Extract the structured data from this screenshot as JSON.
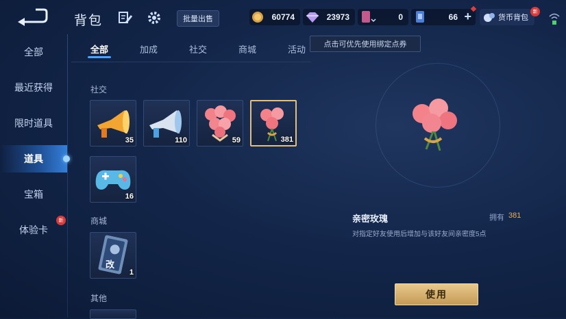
{
  "header": {
    "title": "背包",
    "bulk_sell": "批量出售"
  },
  "currency": {
    "gold": "60774",
    "diamond": "23973",
    "voucher": "0",
    "token": "66",
    "wallet_label": "货币背包",
    "wallet_badge": "新"
  },
  "tooltip": "点击可优先使用绑定点券",
  "sidebar": {
    "items": [
      {
        "label": "全部"
      },
      {
        "label": "最近获得"
      },
      {
        "label": "限时道具"
      },
      {
        "label": "道具"
      },
      {
        "label": "宝箱"
      },
      {
        "label": "体验卡"
      }
    ],
    "badge": "新"
  },
  "tabs": [
    "全部",
    "加成",
    "社交",
    "商城",
    "活动"
  ],
  "sections": {
    "social": "社交",
    "mall": "商城",
    "other": "其他"
  },
  "items": {
    "horn_gold": "35",
    "horn_silver": "110",
    "rose_heart": "59",
    "rose_bouquet": "381",
    "gamepad": "16",
    "rename_card": "1",
    "rename_card_glyph": "改"
  },
  "detail": {
    "name": "亲密玫瑰",
    "own_label": "拥有",
    "own_value": "381",
    "desc": "对指定好友使用后增加与该好友间亲密度5点",
    "use": "使用"
  },
  "colors": {
    "accent": "#4aa3ff",
    "gold": "#e3b15c"
  }
}
